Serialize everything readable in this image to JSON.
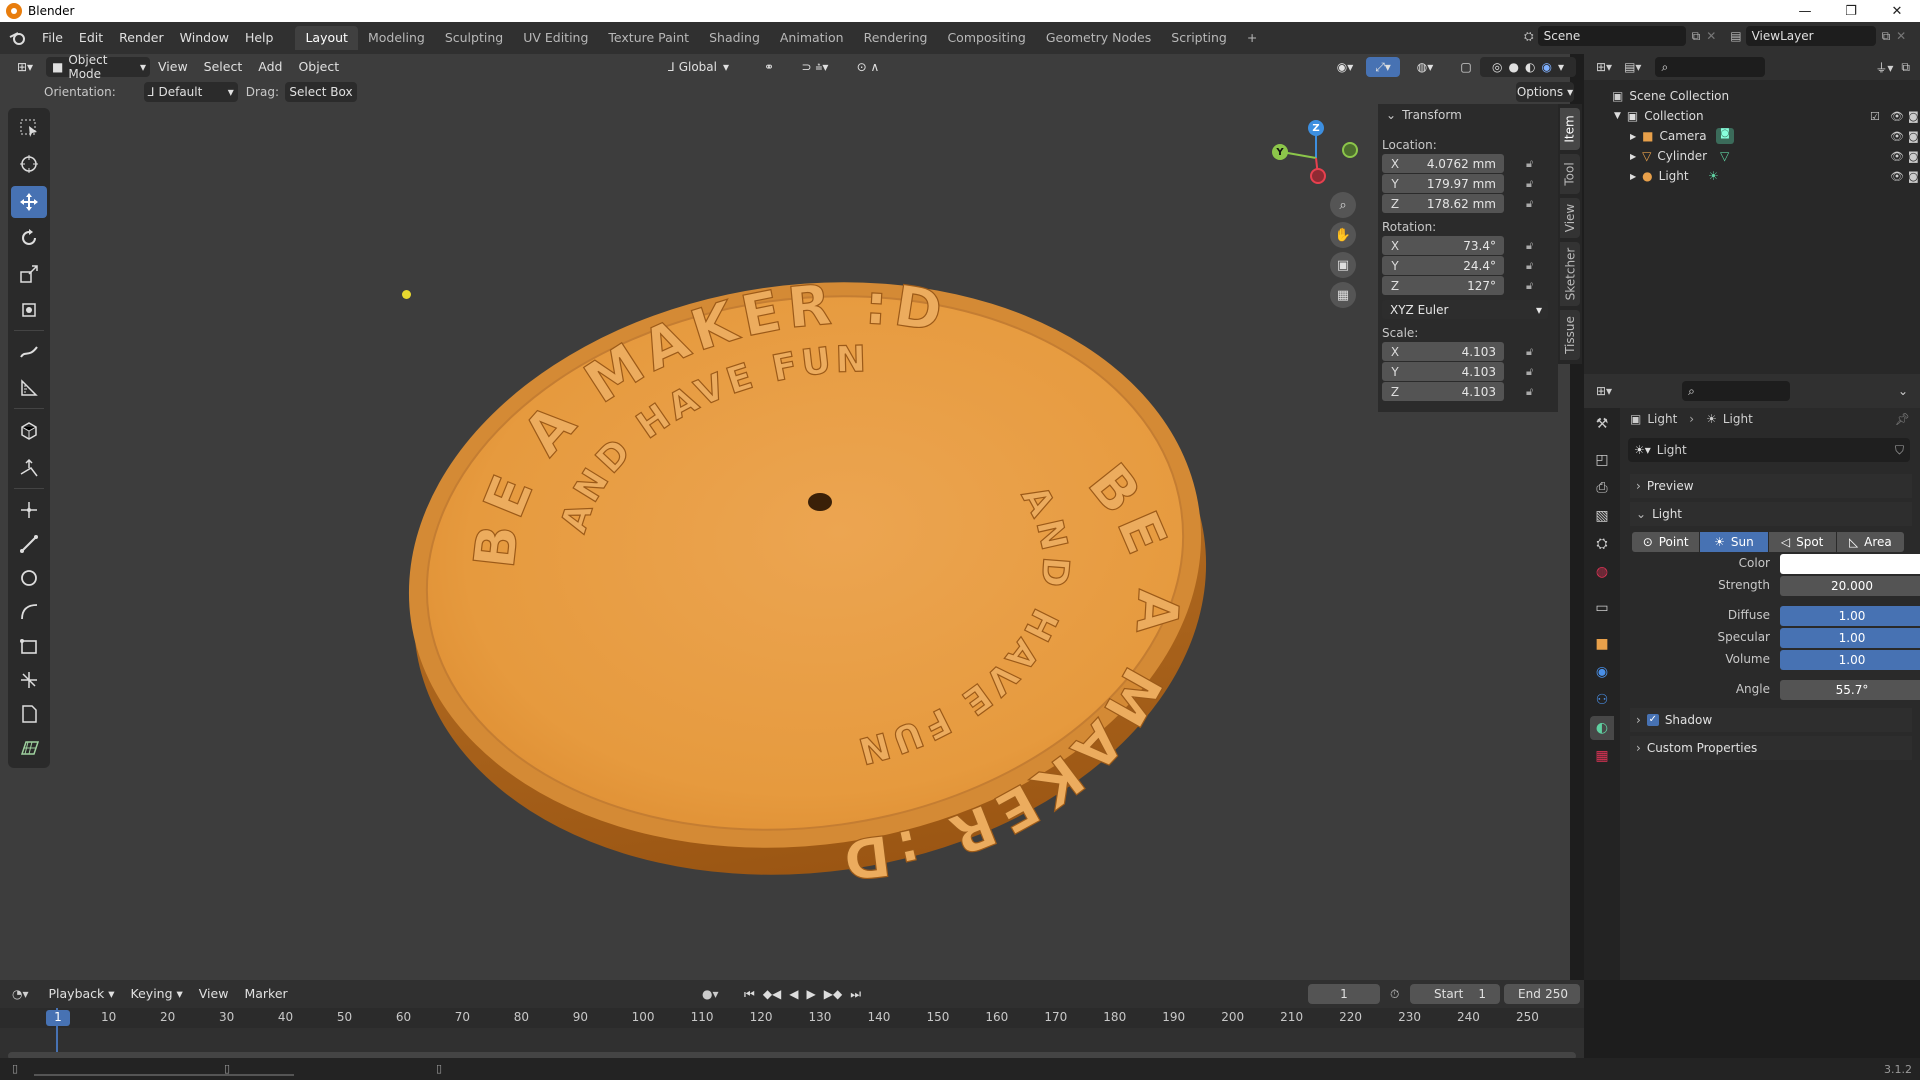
{
  "window": {
    "title": "Blender",
    "minimize": "—",
    "maximize": "❐",
    "close": "✕"
  },
  "menu": [
    "File",
    "Edit",
    "Render",
    "Window",
    "Help"
  ],
  "workspaces": [
    "Layout",
    "Modeling",
    "Sculpting",
    "UV Editing",
    "Texture Paint",
    "Shading",
    "Animation",
    "Rendering",
    "Compositing",
    "Geometry Nodes",
    "Scripting",
    "+"
  ],
  "active_workspace": "Layout",
  "scene": {
    "label": "Scene",
    "view_layer": "ViewLayer"
  },
  "viewport_header": {
    "mode": "Object Mode",
    "menus": [
      "View",
      "Select",
      "Add",
      "Object"
    ],
    "transform_orientation": "Global",
    "options": "Options",
    "orientation_label": "Orientation:",
    "orientation_value": "Default",
    "drag_label": "Drag:",
    "drag_value": "Select Box"
  },
  "n_panel": {
    "title": "Transform",
    "location_label": "Location:",
    "location": {
      "x": "4.0762 mm",
      "y": "179.97 mm",
      "z": "178.62 mm"
    },
    "rotation_label": "Rotation:",
    "rotation": {
      "x": "73.4°",
      "y": "24.4°",
      "z": "127°"
    },
    "rotation_mode": "XYZ Euler",
    "scale_label": "Scale:",
    "scale": {
      "x": "4.103",
      "y": "4.103",
      "z": "4.103"
    },
    "axis_labels": [
      "X",
      "Y",
      "Z"
    ],
    "tabs": [
      "Item",
      "Tool",
      "View",
      "Sketcher",
      "Tissue"
    ]
  },
  "coin": {
    "outer_top": "BE A MAKER :D",
    "inner_top": "AND HAVE FUN",
    "outer_right": "BE A MAKER :D",
    "inner_right": "AND HAVE FUN",
    "color_top": "#e8a04a",
    "color_side": "#b86a1c"
  },
  "outliner": {
    "root": "Scene Collection",
    "collection": "Collection",
    "items": [
      "Camera",
      "Cylinder",
      "Light"
    ]
  },
  "properties": {
    "breadcrumb_object": "Light",
    "breadcrumb_data": "Light",
    "datablock": "Light",
    "preview": "Preview",
    "light_panel": "Light",
    "light_types": [
      "Point",
      "Sun",
      "Spot",
      "Area"
    ],
    "active_type": "Sun",
    "color_label": "Color",
    "color_value": "#ffffff",
    "strength_label": "Strength",
    "strength": "20.000",
    "diffuse_label": "Diffuse",
    "diffuse": "1.00",
    "specular_label": "Specular",
    "specular": "1.00",
    "volume_label": "Volume",
    "volume": "1.00",
    "angle_label": "Angle",
    "angle": "55.7°",
    "shadow": "Shadow",
    "custom_props": "Custom Properties"
  },
  "timeline": {
    "menus": [
      "Playback",
      "Keying",
      "View",
      "Marker"
    ],
    "current_frame": "1",
    "start_label": "Start",
    "start": "1",
    "end_label": "End",
    "end": "250",
    "ticks": [
      "1",
      "10",
      "20",
      "30",
      "40",
      "50",
      "60",
      "70",
      "80",
      "90",
      "100",
      "110",
      "120",
      "130",
      "140",
      "150",
      "160",
      "170",
      "180",
      "190",
      "200",
      "210",
      "220",
      "230",
      "240",
      "250"
    ]
  },
  "status": {
    "version": "3.1.2"
  },
  "colors": {
    "accent": "#4772b3",
    "header": "#303030",
    "viewport": "#3d3d3d",
    "x_axis": "#e8404f",
    "y_axis": "#8cc64a",
    "z_axis": "#3d8fe0"
  }
}
